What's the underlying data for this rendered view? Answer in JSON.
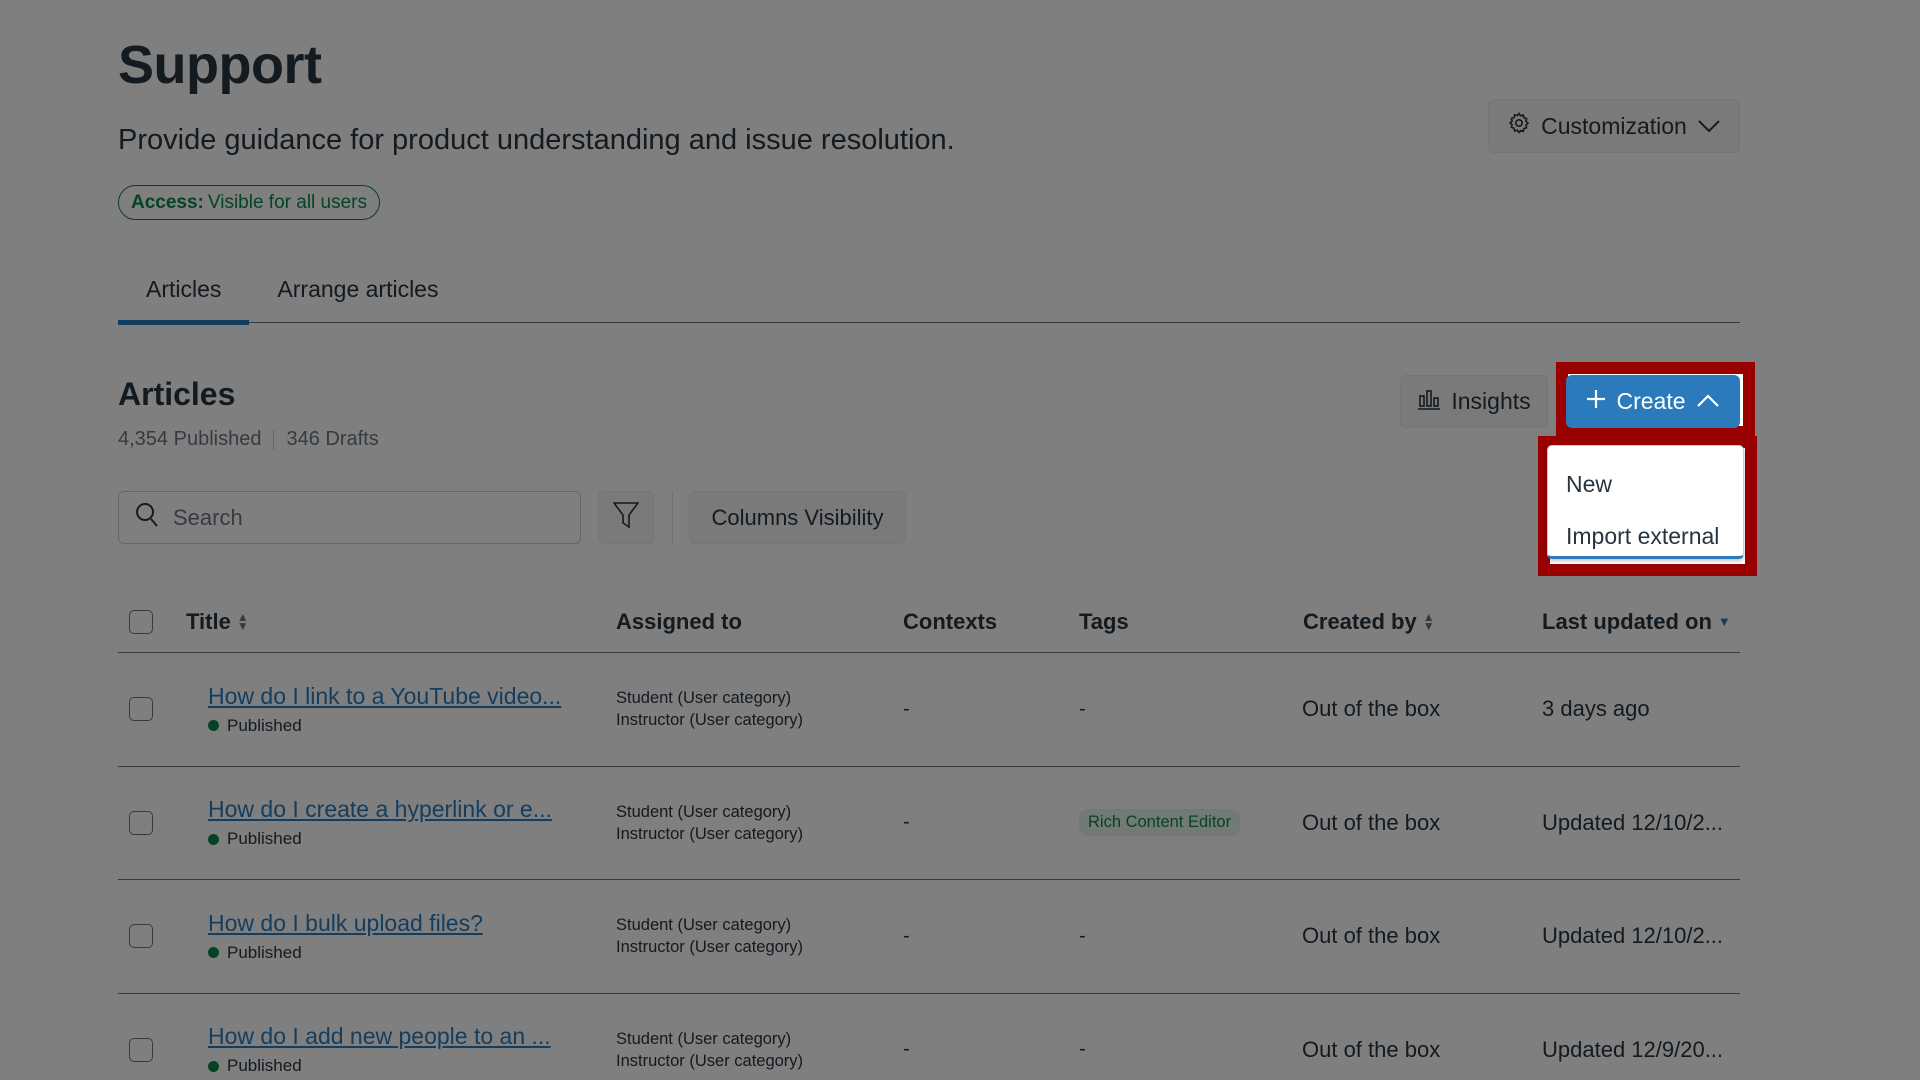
{
  "header": {
    "title": "Support",
    "subtitle": "Provide guidance for product understanding and issue resolution.",
    "access_label": "Access:",
    "access_value": "Visible for all users",
    "customization_label": "Customization"
  },
  "tabs": [
    {
      "label": "Articles",
      "active": true
    },
    {
      "label": "Arrange articles",
      "active": false
    }
  ],
  "articles": {
    "heading": "Articles",
    "published_count": "4,354 Published",
    "drafts_count": "346 Drafts",
    "insights_label": "Insights",
    "create_label": "Create",
    "create_menu": [
      {
        "label": "New"
      },
      {
        "label": "Import external"
      }
    ]
  },
  "toolbar": {
    "search_placeholder": "Search",
    "search_value": "",
    "columns_visibility_label": "Columns Visibility"
  },
  "table": {
    "columns": [
      {
        "label": "Title",
        "sortable": true
      },
      {
        "label": "Assigned to"
      },
      {
        "label": "Contexts"
      },
      {
        "label": "Tags"
      },
      {
        "label": "Created by",
        "sortable": true
      },
      {
        "label": "Last updated on",
        "sorted": "desc"
      }
    ],
    "rows": [
      {
        "title": "How do I link to a YouTube video...",
        "status": "Published",
        "assigned": [
          "Student (User category)",
          "Instructor (User category)"
        ],
        "contexts": "-",
        "tags": "-",
        "created_by": "Out of the box",
        "last_updated": "3 days ago"
      },
      {
        "title": "How do I create a hyperlink or e...",
        "status": "Published",
        "assigned": [
          "Student (User category)",
          "Instructor (User category)"
        ],
        "contexts": "-",
        "tags": "Rich Content Editor",
        "created_by": "Out of the box",
        "last_updated": "Updated 12/10/2..."
      },
      {
        "title": "How do I bulk upload files?",
        "status": "Published",
        "assigned": [
          "Student (User category)",
          "Instructor (User category)"
        ],
        "contexts": "-",
        "tags": "-",
        "created_by": "Out of the box",
        "last_updated": "Updated 12/10/2..."
      },
      {
        "title": "How do I add new people to an ...",
        "status": "Published",
        "assigned": [
          "Student (User category)",
          "Instructor (User category)"
        ],
        "contexts": "-",
        "tags": "-",
        "created_by": "Out of the box",
        "last_updated": "Updated 12/9/20..."
      }
    ]
  },
  "colors": {
    "brand": "#2b7abc",
    "success": "#0b874b",
    "highlight_outline": "#990000"
  }
}
